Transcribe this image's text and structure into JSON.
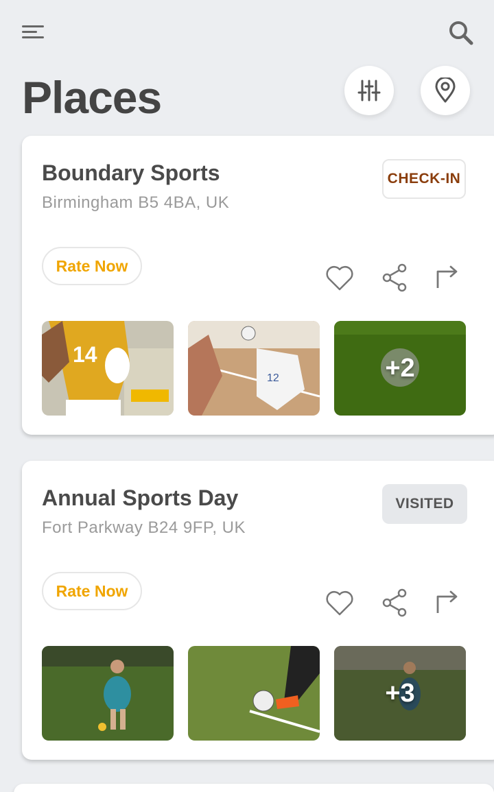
{
  "header": {
    "menu_icon": "menu-icon",
    "search_icon": "search-icon",
    "title": "Places",
    "filter_icon": "sliders-icon",
    "location_icon": "map-pin-icon"
  },
  "colors": {
    "background": "#eceef1",
    "card": "#ffffff",
    "rate_accent": "#f0a500",
    "checkin_text": "#8a3d0c",
    "visited_badge_bg": "#e6e8eb"
  },
  "places": [
    {
      "name": "Boundary Sports",
      "address": "Birmingham B5 4BA, UK",
      "status": "CHECK-IN",
      "rate_label": "Rate Now",
      "actions": [
        "heart-icon",
        "share-icon",
        "forward-icon"
      ],
      "photos": [
        "volleyball-player-back-photo",
        "volleyball-spike-photo",
        "grass-field-photo"
      ],
      "more_count": "+2"
    },
    {
      "name": "Annual Sports Day",
      "address": "Fort Parkway B24 9FP, UK",
      "status": "VISITED",
      "rate_label": "Rate Now",
      "actions": [
        "heart-icon",
        "share-icon",
        "forward-icon"
      ],
      "photos": [
        "boy-soccer-photo",
        "soccer-kick-photo",
        "soccer-player-photo"
      ],
      "more_count": "+3"
    }
  ]
}
